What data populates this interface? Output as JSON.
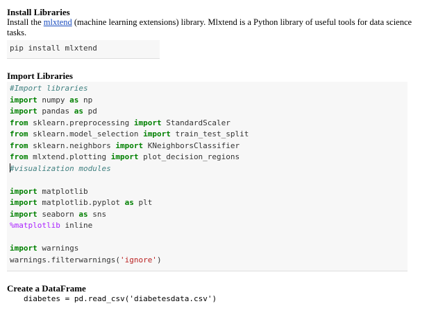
{
  "install": {
    "title": "Install Libraries",
    "desc_before": "Install the ",
    "link_text": "mlxtend",
    "desc_after": " (machine learning extensions) library. Mlxtend is a Python library of useful tools for data science tasks.",
    "command": "pip install mlxtend"
  },
  "imports": {
    "title": "Import Libraries",
    "lines": [
      [
        {
          "t": "#Import libraries",
          "c": "cm"
        }
      ],
      [
        {
          "t": "import",
          "c": "kw"
        },
        {
          "t": " numpy ",
          "c": ""
        },
        {
          "t": "as",
          "c": "kw"
        },
        {
          "t": " np",
          "c": ""
        }
      ],
      [
        {
          "t": "import",
          "c": "kw"
        },
        {
          "t": " pandas ",
          "c": ""
        },
        {
          "t": "as",
          "c": "kw"
        },
        {
          "t": " pd",
          "c": ""
        }
      ],
      [
        {
          "t": "from",
          "c": "kw"
        },
        {
          "t": " sklearn.preprocessing ",
          "c": ""
        },
        {
          "t": "import",
          "c": "kw"
        },
        {
          "t": " StandardScaler",
          "c": ""
        }
      ],
      [
        {
          "t": "from",
          "c": "kw"
        },
        {
          "t": " sklearn.model_selection ",
          "c": ""
        },
        {
          "t": "import",
          "c": "kw"
        },
        {
          "t": " train_test_split",
          "c": ""
        }
      ],
      [
        {
          "t": "from",
          "c": "kw"
        },
        {
          "t": " sklearn.neighbors ",
          "c": ""
        },
        {
          "t": "import",
          "c": "kw"
        },
        {
          "t": " KNeighborsClassifier",
          "c": ""
        }
      ],
      [
        {
          "t": "from",
          "c": "kw"
        },
        {
          "t": " mlxtend.plotting ",
          "c": ""
        },
        {
          "t": "import",
          "c": "kw"
        },
        {
          "t": " plot_decision_regions",
          "c": ""
        }
      ],
      [
        {
          "t": "#visualization modules",
          "c": "cm",
          "cursor": true
        }
      ],
      [],
      [
        {
          "t": "import",
          "c": "kw"
        },
        {
          "t": " matplotlib",
          "c": ""
        }
      ],
      [
        {
          "t": "import",
          "c": "kw"
        },
        {
          "t": " matplotlib.pyplot ",
          "c": ""
        },
        {
          "t": "as",
          "c": "kw"
        },
        {
          "t": " plt",
          "c": ""
        }
      ],
      [
        {
          "t": "import",
          "c": "kw"
        },
        {
          "t": " seaborn ",
          "c": ""
        },
        {
          "t": "as",
          "c": "kw"
        },
        {
          "t": " sns",
          "c": ""
        }
      ],
      [
        {
          "t": "%matplotlib",
          "c": "mg"
        },
        {
          "t": " inline",
          "c": ""
        }
      ],
      [],
      [
        {
          "t": "import",
          "c": "kw"
        },
        {
          "t": " warnings",
          "c": ""
        }
      ],
      [
        {
          "t": "warnings.filterwarnings(",
          "c": ""
        },
        {
          "t": "'ignore'",
          "c": "st"
        },
        {
          "t": ")",
          "c": ""
        }
      ]
    ]
  },
  "dataframe": {
    "title": "Create a DataFrame",
    "code": "diabetes = pd.read_csv('diabetesdata.csv')"
  }
}
